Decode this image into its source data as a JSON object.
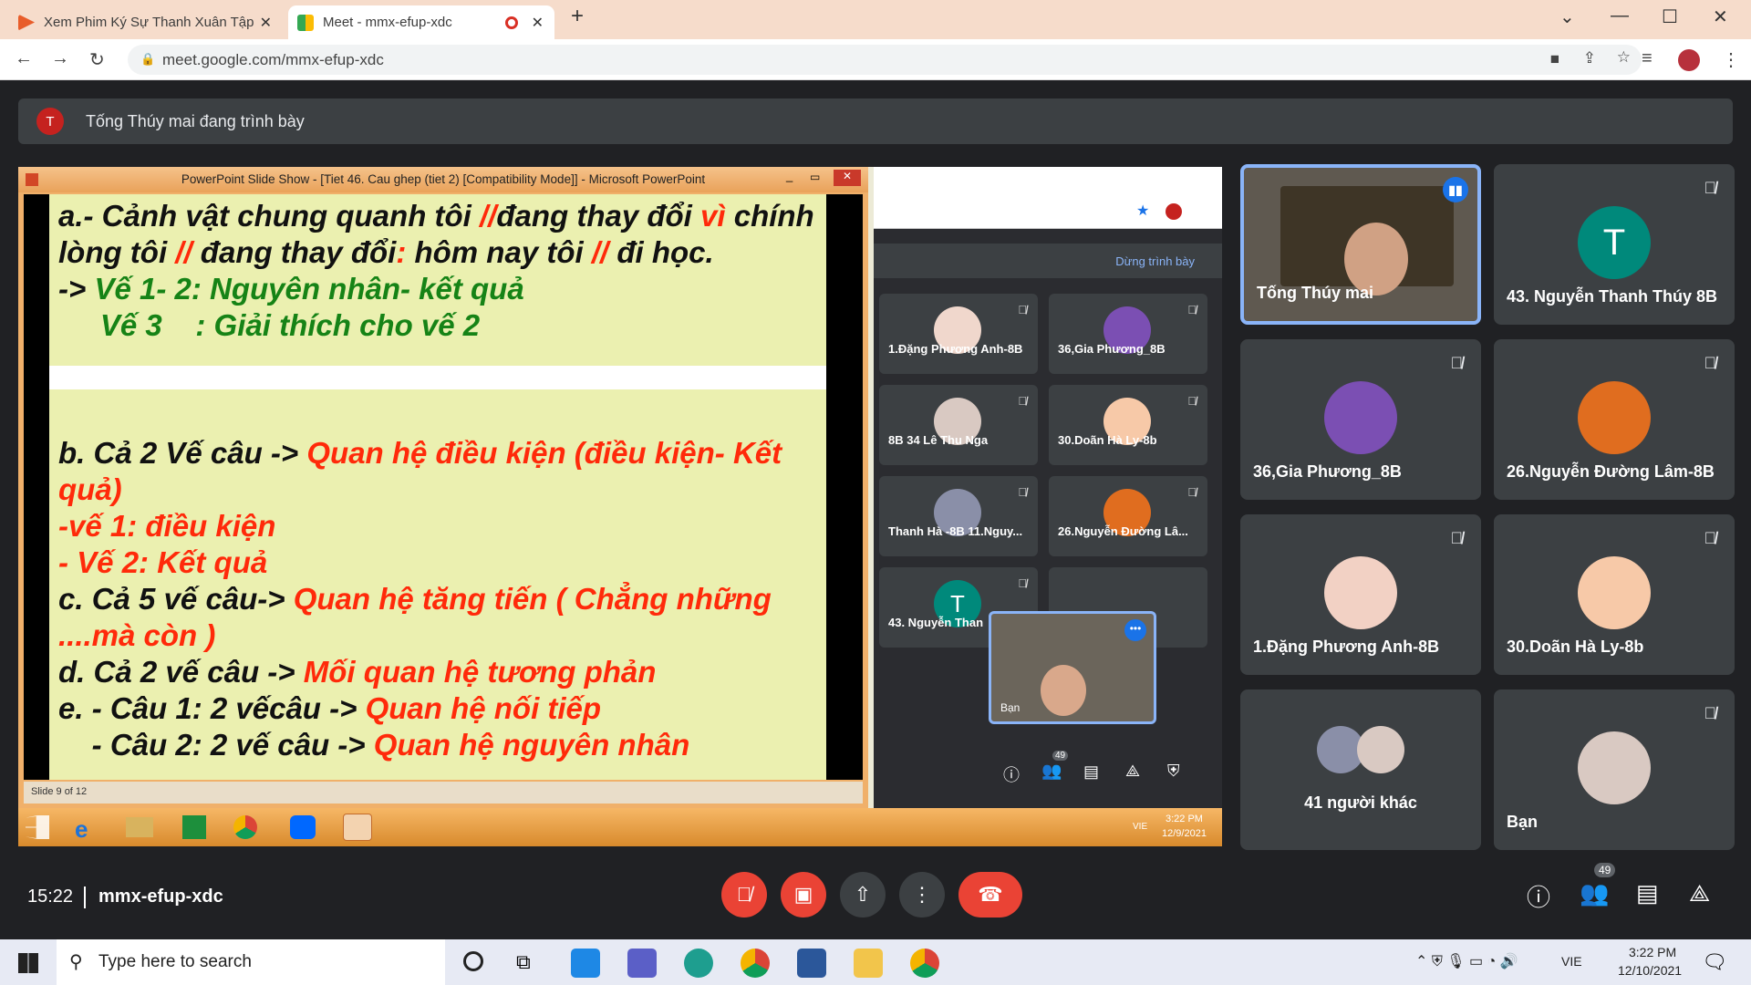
{
  "browser": {
    "tabs": [
      {
        "title": "Xem Phim Ký Sự Thanh Xuân Tập",
        "active": false
      },
      {
        "title": "Meet - mmx-efup-xdc",
        "active": true
      }
    ],
    "url": "meet.google.com/mmx-efup-xdc"
  },
  "presentation_banner": {
    "avatar_letter": "T",
    "text": "Tống Thúy mai đang trình bày"
  },
  "powerpoint": {
    "title": "PowerPoint Slide Show - [Tiet 46. Cau ghep (tiet 2) [Compatibility Mode]] - Microsoft PowerPoint",
    "status": "Slide 9 of 12",
    "slide_lines": [
      {
        "parts": [
          {
            "t": "a.- Cảnh vật chung quanh tôi ",
            "c": "k"
          },
          {
            "t": "//",
            "c": "r"
          },
          {
            "t": "đang thay đổi ",
            "c": "k"
          },
          {
            "t": "vì",
            "c": "r"
          },
          {
            "t": " chính",
            "c": "k"
          }
        ]
      },
      {
        "parts": [
          {
            "t": "lòng tôi ",
            "c": "k"
          },
          {
            "t": "//",
            "c": "r"
          },
          {
            "t": " đang thay đổi",
            "c": "k"
          },
          {
            "t": ":",
            "c": "r"
          },
          {
            "t": " hôm nay tôi ",
            "c": "k"
          },
          {
            "t": "//",
            "c": "r"
          },
          {
            "t": " đi học.",
            "c": "k"
          }
        ]
      },
      {
        "parts": [
          {
            "t": "-> ",
            "c": "k"
          },
          {
            "t": "Vế 1- 2: Nguyên nhân- kết quả",
            "c": "g"
          }
        ]
      },
      {
        "parts": [
          {
            "t": "     Vế 3    : Giải thích cho vế 2",
            "c": "g"
          }
        ]
      }
    ],
    "slide_lines_b": [
      {
        "parts": [
          {
            "t": "b. Cả 2 Vế câu -> ",
            "c": "k"
          },
          {
            "t": "Quan hệ điều kiện (điều kiện- Kết",
            "c": "r"
          }
        ]
      },
      {
        "parts": [
          {
            "t": "quả)",
            "c": "r"
          }
        ]
      },
      {
        "parts": [
          {
            "t": "-vế 1: điều kiện",
            "c": "r"
          }
        ]
      },
      {
        "parts": [
          {
            "t": "- Vế 2: Kết quả",
            "c": "r"
          }
        ]
      },
      {
        "parts": [
          {
            "t": "c. Cả 5 vế câu-> ",
            "c": "k"
          },
          {
            "t": "Quan hệ tăng tiến ( Chẳng những",
            "c": "r"
          }
        ]
      },
      {
        "parts": [
          {
            "t": "....mà còn )",
            "c": "r"
          }
        ]
      },
      {
        "parts": [
          {
            "t": "d. Cả 2 vế câu -> ",
            "c": "k"
          },
          {
            "t": "Mối quan hệ tương phản",
            "c": "r"
          }
        ]
      },
      {
        "parts": [
          {
            "t": "e. - Câu 1: 2 vếcâu -> ",
            "c": "k"
          },
          {
            "t": "Quan hệ nối tiếp",
            "c": "r"
          }
        ]
      },
      {
        "parts": [
          {
            "t": "    - Câu 2: 2 vế câu -> ",
            "c": "k"
          },
          {
            "t": "Quan hệ nguyên nhân",
            "c": "r"
          }
        ]
      }
    ]
  },
  "inner_taskbar": {
    "time": "3:22 PM",
    "date": "12/9/2021",
    "lang": "VIE"
  },
  "inner_meet": {
    "stop_presenting": "Dừng trình bày",
    "people_count": "49",
    "tiles": [
      {
        "name": "1.Đặng Phương Anh-8B"
      },
      {
        "name": "36,Gia Phương_8B"
      },
      {
        "name": "8B 34 Lê Thu Nga"
      },
      {
        "name": "30.Doãn Hà Ly-8b"
      },
      {
        "name": "Thanh Hà -8B 11.Nguy..."
      },
      {
        "name": "26.Nguyễn Đường Lâ..."
      },
      {
        "name": "43. Nguyễn Than",
        "letter": "T"
      }
    ],
    "self_label": "Bạn"
  },
  "participants": [
    {
      "name": "Tống Thúy mai",
      "kind": "video",
      "speaking": true
    },
    {
      "name": "43. Nguyễn Thanh Thúy 8B",
      "letter": "T",
      "color": "#00897b"
    },
    {
      "name": "36,Gia Phương_8B",
      "color": "#7b4fb3"
    },
    {
      "name": "26.Nguyễn Đường Lâm-8B",
      "color": "#e06d1f"
    },
    {
      "name": "1.Đặng Phương Anh-8B",
      "color": "#f2d1c4"
    },
    {
      "name": "30.Doãn Hà Ly-8b",
      "color": "#f7c9a8"
    },
    {
      "name": "41 người khác",
      "kind": "others"
    },
    {
      "name": "Bạn",
      "color": "#d9c9c2"
    }
  ],
  "bottom": {
    "time": "15:22",
    "meeting_code": "mmx-efup-xdc",
    "people_count": "49"
  },
  "taskbar": {
    "search_placeholder": "Type here to search",
    "time": "3:22 PM",
    "date": "12/10/2021",
    "lang": "VIE"
  }
}
